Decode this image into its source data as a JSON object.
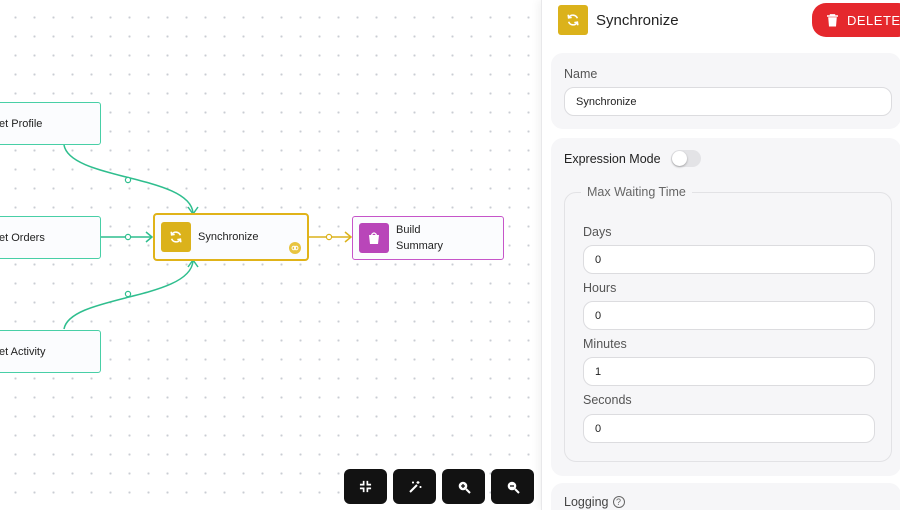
{
  "canvas": {
    "nodes": {
      "get_profile": "et Profile",
      "get_orders": "et Orders",
      "get_activity": "et Activity",
      "synchronize": "Synchronize",
      "build_summary_line1": "Build",
      "build_summary_line2": "Summary"
    },
    "toolbar": {
      "fit_icon": "compress-icon",
      "magic_icon": "magic-wand-icon",
      "zoom_in_icon": "zoom-in-icon",
      "zoom_out_icon": "zoom-out-icon"
    }
  },
  "panel": {
    "title": "Synchronize",
    "title_icon": "sync-icon",
    "delete_label": "DELETE",
    "name_label": "Name",
    "name_value": "Synchronize",
    "expression_mode_label": "Expression Mode",
    "expression_mode_on": false,
    "max_waiting_legend": "Max Waiting Time",
    "days_label": "Days",
    "days_value": "0",
    "hours_label": "Hours",
    "hours_value": "0",
    "minutes_label": "Minutes",
    "minutes_value": "1",
    "seconds_label": "Seconds",
    "seconds_value": "0",
    "logging_label": "Logging"
  },
  "colors": {
    "edge_green": "#2fbe8e",
    "edge_yellow": "#dbb21b",
    "sync_yellow": "#dbb21b",
    "build_purple": "#b946b9",
    "delete_red": "#e5282d"
  }
}
